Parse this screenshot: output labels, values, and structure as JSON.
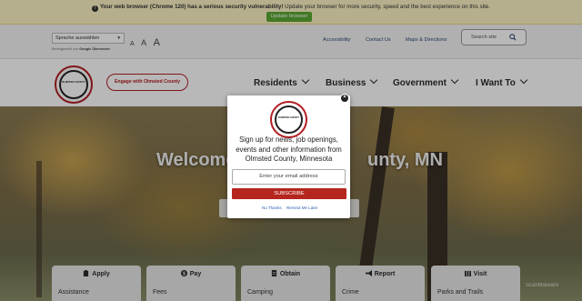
{
  "browser_warning": {
    "bold": "Your web browser (Chrome 120) has a serious security vulnerability!",
    "rest": " Update your browser for more security, speed and the best experience on this site.",
    "update_button": "Update browser"
  },
  "utility": {
    "language_select": "Sprache auswählen",
    "powered_by_prefix": "Bereitgestellt von",
    "powered_by_brand": "Google Übersetzer",
    "text_sizes": [
      "A",
      "A",
      "A"
    ],
    "links": [
      "Accessibility",
      "Contact Us",
      "Maps & Directions"
    ],
    "search_placeholder": "Search site"
  },
  "header": {
    "logo_text": "OLMSTED COUNTY",
    "engage_button": "Engage with Olmsted County",
    "nav": [
      "Residents",
      "Business",
      "Government",
      "I Want To"
    ]
  },
  "hero": {
    "title_left": "Welcome",
    "title_right": "unty, MN"
  },
  "cards": [
    {
      "title": "Apply",
      "sub": "Assistance",
      "icon": "clipboard-icon"
    },
    {
      "title": "Pay",
      "sub": "Fees",
      "icon": "dollar-icon"
    },
    {
      "title": "Obtain",
      "sub": "Camping",
      "icon": "document-icon"
    },
    {
      "title": "Report",
      "sub": "Crime",
      "icon": "megaphone-icon"
    },
    {
      "title": "Visit",
      "sub": "Parks and Trails",
      "icon": "book-icon"
    }
  ],
  "watermark": "ScanMalware",
  "modal": {
    "logo_text": "OLMSTED COUNTY",
    "message": "Sign up for news, job openings, events and other information from Olmsted County, Minnesota",
    "email_placeholder": "Enter your email address",
    "subscribe_button": "SUBSCRIBE",
    "no_thanks": "No Thanks",
    "remind_later": "Remind Me Later",
    "close": "×"
  },
  "colors": {
    "brand_red": "#b21e23",
    "update_green": "#5aa832",
    "warning_bg": "#fdf3c4"
  }
}
